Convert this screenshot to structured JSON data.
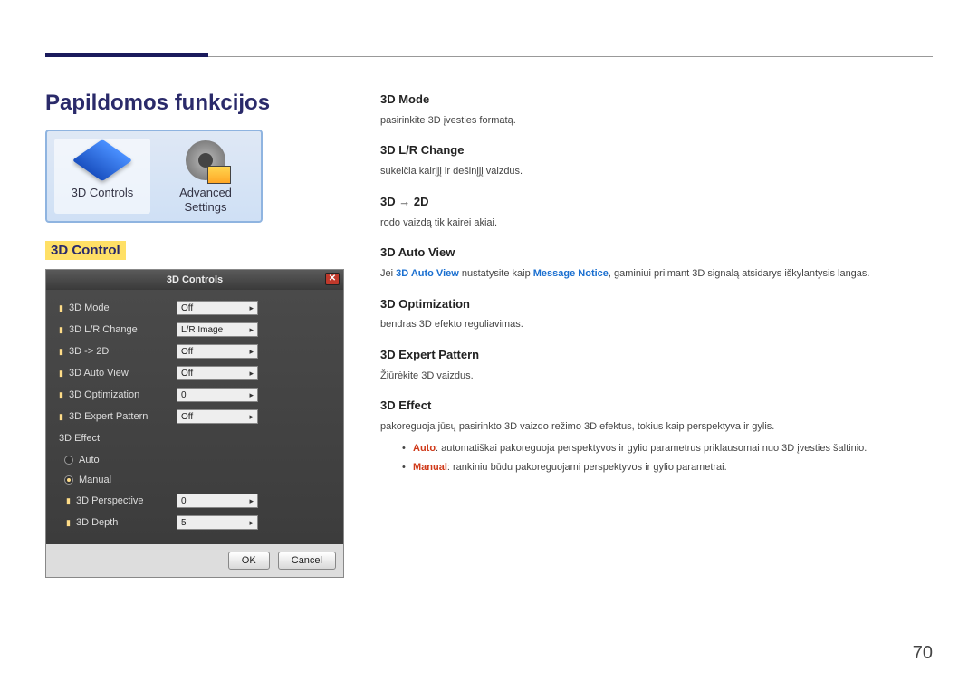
{
  "page_title": "Papildomos funkcijos",
  "icon_tiles": [
    {
      "label": "3D Controls"
    },
    {
      "label": "Advanced\nSettings"
    }
  ],
  "section_heading": "3D Control",
  "dialog": {
    "title": "3D Controls",
    "rows": [
      {
        "label": "3D Mode",
        "value": "Off"
      },
      {
        "label": "3D L/R Change",
        "value": "L/R Image"
      },
      {
        "label": "3D -> 2D",
        "value": "Off"
      },
      {
        "label": "3D Auto View",
        "value": "Off"
      },
      {
        "label": "3D Optimization",
        "value": "0"
      },
      {
        "label": "3D Expert Pattern",
        "value": "Off"
      }
    ],
    "effect_section": "3D Effect",
    "radios": {
      "auto": "Auto",
      "manual": "Manual"
    },
    "sub_rows": [
      {
        "label": "3D Perspective",
        "value": "0"
      },
      {
        "label": "3D Depth",
        "value": "5"
      }
    ],
    "buttons": {
      "ok": "OK",
      "cancel": "Cancel"
    }
  },
  "right": {
    "mode": {
      "h": "3D Mode",
      "p": "pasirinkite 3D įvesties formatą."
    },
    "lr": {
      "h": "3D L/R Change",
      "p": "sukeičia kairįjį ir dešinįjį vaizdus."
    },
    "d3to2d": {
      "h": "3D → 2D",
      "p": "rodo vaizdą tik kairei akiai."
    },
    "autoview": {
      "h": "3D Auto View",
      "pre": "Jei ",
      "kw1": "3D Auto View",
      "mid": " nustatysite kaip ",
      "kw2": "Message Notice",
      "post": ", gaminiui priimant 3D signalą atsidarys iškylantysis langas."
    },
    "opt": {
      "h": "3D Optimization",
      "p": "bendras 3D efekto reguliavimas."
    },
    "expert": {
      "h": "3D Expert Pattern",
      "p": "Žiūrėkite 3D vaizdus."
    },
    "effect": {
      "h": "3D Effect",
      "p": "pakoreguoja jūsų pasirinkto 3D vaizdo režimo 3D efektus, tokius kaip perspektyva ir gylis.",
      "auto_kw": "Auto",
      "auto_txt": ": automatiškai pakoreguoja perspektyvos ir gylio parametrus priklausomai nuo 3D įvesties šaltinio.",
      "manual_kw": "Manual",
      "manual_txt": ": rankiniu būdu pakoreguojami perspektyvos ir gylio parametrai."
    }
  },
  "page_number": "70"
}
